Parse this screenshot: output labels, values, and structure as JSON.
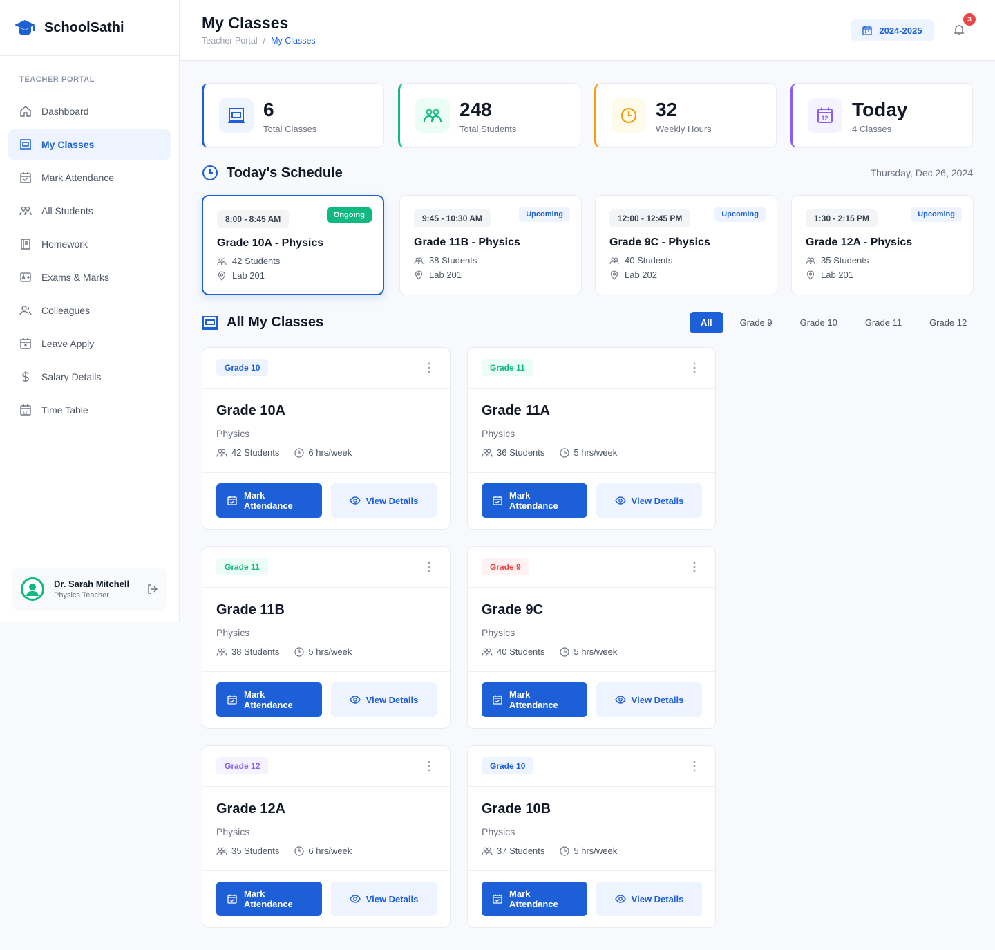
{
  "brand": {
    "name": "SchoolSathi"
  },
  "sidebar": {
    "section_label": "TEACHER PORTAL",
    "items": [
      {
        "label": "Dashboard",
        "icon": "home-icon"
      },
      {
        "label": "My Classes",
        "icon": "classroom-icon",
        "active": true
      },
      {
        "label": "Mark Attendance",
        "icon": "calendar-check-icon"
      },
      {
        "label": "All Students",
        "icon": "users-icon"
      },
      {
        "label": "Homework",
        "icon": "notebook-icon"
      },
      {
        "label": "Exams & Marks",
        "icon": "grade-icon"
      },
      {
        "label": "Colleagues",
        "icon": "colleagues-icon"
      },
      {
        "label": "Leave Apply",
        "icon": "calendar-x-icon"
      },
      {
        "label": "Salary Details",
        "icon": "dollar-icon"
      },
      {
        "label": "Time Table",
        "icon": "calendar-icon"
      }
    ],
    "profile": {
      "name": "Dr. Sarah Mitchell",
      "role": "Physics Teacher"
    }
  },
  "header": {
    "title": "My Classes",
    "breadcrumb": [
      "Teacher Portal",
      "/",
      "My Classes"
    ],
    "year": "2024-2025",
    "notifications": "3"
  },
  "stats": [
    {
      "value": "6",
      "label": "Total Classes",
      "color": "#1d5fd6"
    },
    {
      "value": "248",
      "label": "Total Students",
      "color": "#10b981"
    },
    {
      "value": "32",
      "label": "Weekly Hours",
      "color": "#f59e0b"
    },
    {
      "value": "Today",
      "label": "4 Classes",
      "color": "#8b5cf6"
    }
  ],
  "schedule": {
    "title": "Today's Schedule",
    "date": "Thursday, Dec 26, 2024",
    "items": [
      {
        "time": "8:00 - 8:45 AM",
        "status": "Ongoing",
        "title": "Grade 10A - Physics",
        "students": "42 Students",
        "room": "Lab 201"
      },
      {
        "time": "9:45 - 10:30 AM",
        "status": "Upcoming",
        "title": "Grade 11B - Physics",
        "students": "38 Students",
        "room": "Lab 201"
      },
      {
        "time": "12:00 - 12:45 PM",
        "status": "Upcoming",
        "title": "Grade 9C - Physics",
        "students": "40 Students",
        "room": "Lab 202"
      },
      {
        "time": "1:30 - 2:15 PM",
        "status": "Upcoming",
        "title": "Grade 12A - Physics",
        "students": "35 Students",
        "room": "Lab 201"
      }
    ]
  },
  "classes": {
    "title": "All My Classes",
    "filters": [
      "All",
      "Grade 9",
      "Grade 10",
      "Grade 11",
      "Grade 12"
    ],
    "mark_label_1": "Mark",
    "mark_label_2": "Attendance",
    "view_label": "View Details",
    "cards": [
      {
        "badge": "Grade 10",
        "badge_color": "#1d5fd6",
        "title": "Grade 10A",
        "subject": "Physics",
        "students": "42 Students",
        "hours": "6 hrs/week"
      },
      {
        "badge": "Grade 11",
        "badge_color": "#10b981",
        "title": "Grade 11A",
        "subject": "Physics",
        "students": "36 Students",
        "hours": "5 hrs/week"
      },
      {
        "badge": "Grade 11",
        "badge_color": "#10b981",
        "title": "Grade 11B",
        "subject": "Physics",
        "students": "38 Students",
        "hours": "5 hrs/week"
      },
      {
        "badge": "Grade 9",
        "badge_color": "#ef4444",
        "title": "Grade 9C",
        "subject": "Physics",
        "students": "40 Students",
        "hours": "5 hrs/week"
      },
      {
        "badge": "Grade 12",
        "badge_color": "#8b5cf6",
        "title": "Grade 12A",
        "subject": "Physics",
        "students": "35 Students",
        "hours": "6 hrs/week"
      },
      {
        "badge": "Grade 10",
        "badge_color": "#1d5fd6",
        "title": "Grade 10B",
        "subject": "Physics",
        "students": "37 Students",
        "hours": "5 hrs/week"
      }
    ]
  }
}
